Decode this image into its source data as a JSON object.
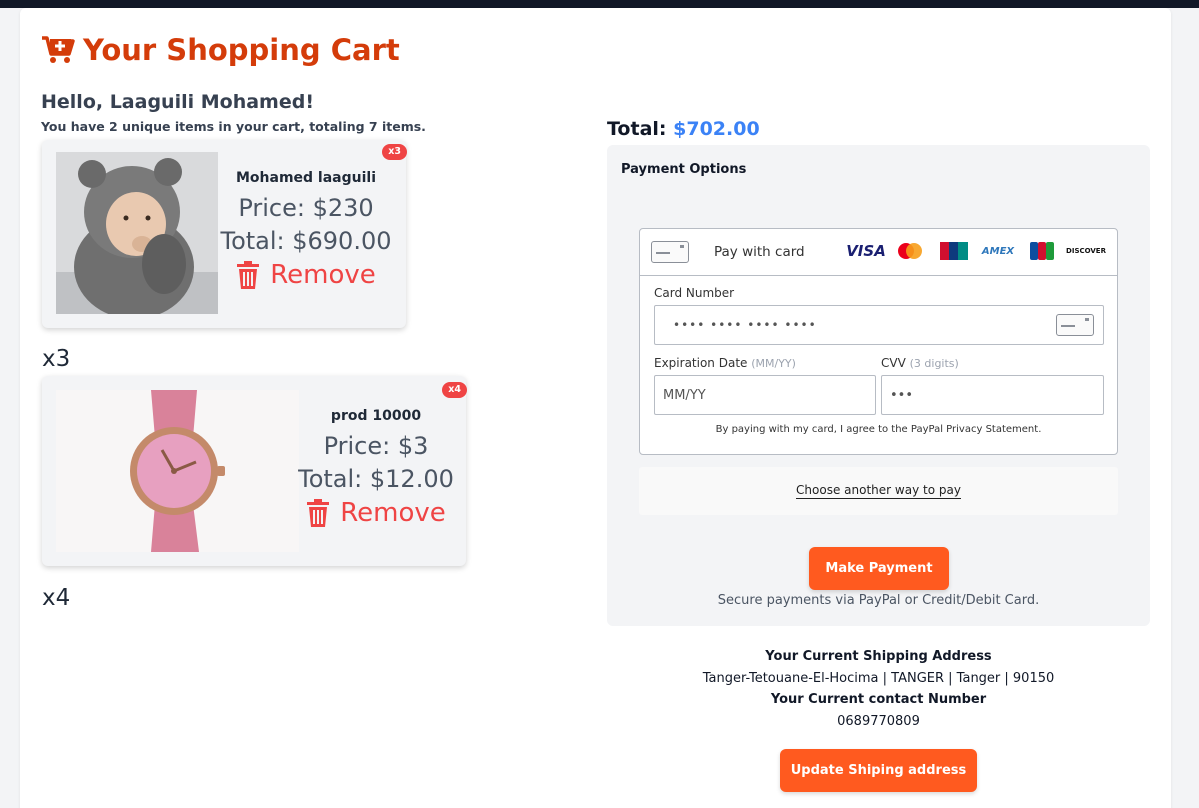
{
  "header": {
    "title": "Your Shopping Cart",
    "icon": "cart-plus-icon",
    "color": "#d43c0a"
  },
  "greeting": "Hello, Laaguili Mohamed!",
  "summary": "You have 2 unique items in your cart, totaling 7 items.",
  "items": [
    {
      "badge": "x3",
      "name": "Mohamed laaguili",
      "price": "Price: $230",
      "total": "Total: $690.00",
      "remove_label": "Remove",
      "qty_label": "x3",
      "image": "baby-in-bear-hoodie"
    },
    {
      "badge": "x4",
      "name": "prod 10000",
      "price": "Price: $3",
      "total": "Total: $12.00",
      "remove_label": "Remove",
      "qty_label": "x4",
      "image": "pink-wristwatch"
    }
  ],
  "cart_total": {
    "label": "Total:",
    "amount": "$702.00"
  },
  "payment": {
    "options_label": "Payment Options",
    "pay_with_card": "Pay with card",
    "brands": [
      "VISA",
      "Mastercard",
      "UnionPay",
      "AMEX",
      "JCB",
      "DISCOVER"
    ],
    "card_number_label": "Card Number",
    "card_number_value": "•••• •••• •••• ••••",
    "expiration_label": "Expiration Date",
    "expiration_hint": "(MM/YY)",
    "expiration_placeholder": "MM/YY",
    "cvv_label": "CVV",
    "cvv_hint": "(3 digits)",
    "cvv_placeholder": "•••",
    "agreement": "By paying with my card, I agree to the PayPal Privacy Statement.",
    "another_way": "Choose another way to pay",
    "make_payment": "Make Payment",
    "secure_note": "Secure payments via PayPal or Credit/Debit Card."
  },
  "shipping": {
    "address_heading": "Your Current Shipping Address",
    "address": "Tanger-Tetouane-El-Hocima | TANGER | Tanger | 90150",
    "contact_heading": "Your Current contact Number",
    "contact": "0689770809",
    "update_button": "Update Shiping address"
  },
  "colors": {
    "accent": "#ff5a1f",
    "danger": "#ef4444",
    "total_amount": "#3b82f6"
  }
}
